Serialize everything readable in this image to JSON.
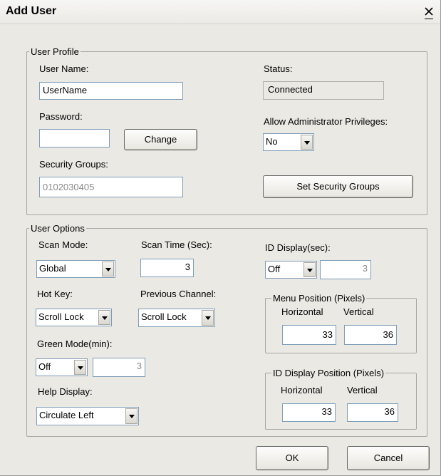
{
  "dialog": {
    "title": "Add User",
    "close_label": "X"
  },
  "user_profile": {
    "legend": "User Profile",
    "user_name_label": "User Name:",
    "user_name_value": "UserName",
    "status_label": "Status:",
    "status_value": "Connected",
    "password_label": "Password:",
    "password_value": "",
    "change_button": "Change",
    "allow_admin_label": "Allow Administrator Privileges:",
    "allow_admin_value": "No",
    "security_groups_label": "Security Groups:",
    "security_groups_value": "0102030405",
    "set_security_groups_button": "Set Security Groups"
  },
  "user_options": {
    "legend": "User Options",
    "scan_mode_label": "Scan Mode:",
    "scan_mode_value": "Global",
    "scan_time_label": "Scan Time (Sec):",
    "scan_time_value": "3",
    "id_display_label": "ID Display(sec):",
    "id_display_value": "Off",
    "id_display_seconds": "3",
    "hot_key_label": "Hot Key:",
    "hot_key_value": "Scroll Lock",
    "previous_channel_label": "Previous Channel:",
    "previous_channel_value": "Scroll Lock",
    "green_mode_label": "Green Mode(min):",
    "green_mode_value": "Off",
    "green_mode_minutes": "3",
    "help_display_label": "Help Display:",
    "help_display_value": "Circulate Left",
    "menu_position": {
      "legend": "Menu Position (Pixels)",
      "horizontal_label": "Horizontal",
      "vertical_label": "Vertical",
      "horizontal_value": "33",
      "vertical_value": "36"
    },
    "id_display_position": {
      "legend": "ID Display Position (Pixels)",
      "horizontal_label": "Horizontal",
      "vertical_label": "Vertical",
      "horizontal_value": "33",
      "vertical_value": "36"
    }
  },
  "footer": {
    "ok_button": "OK",
    "cancel_button": "Cancel"
  }
}
